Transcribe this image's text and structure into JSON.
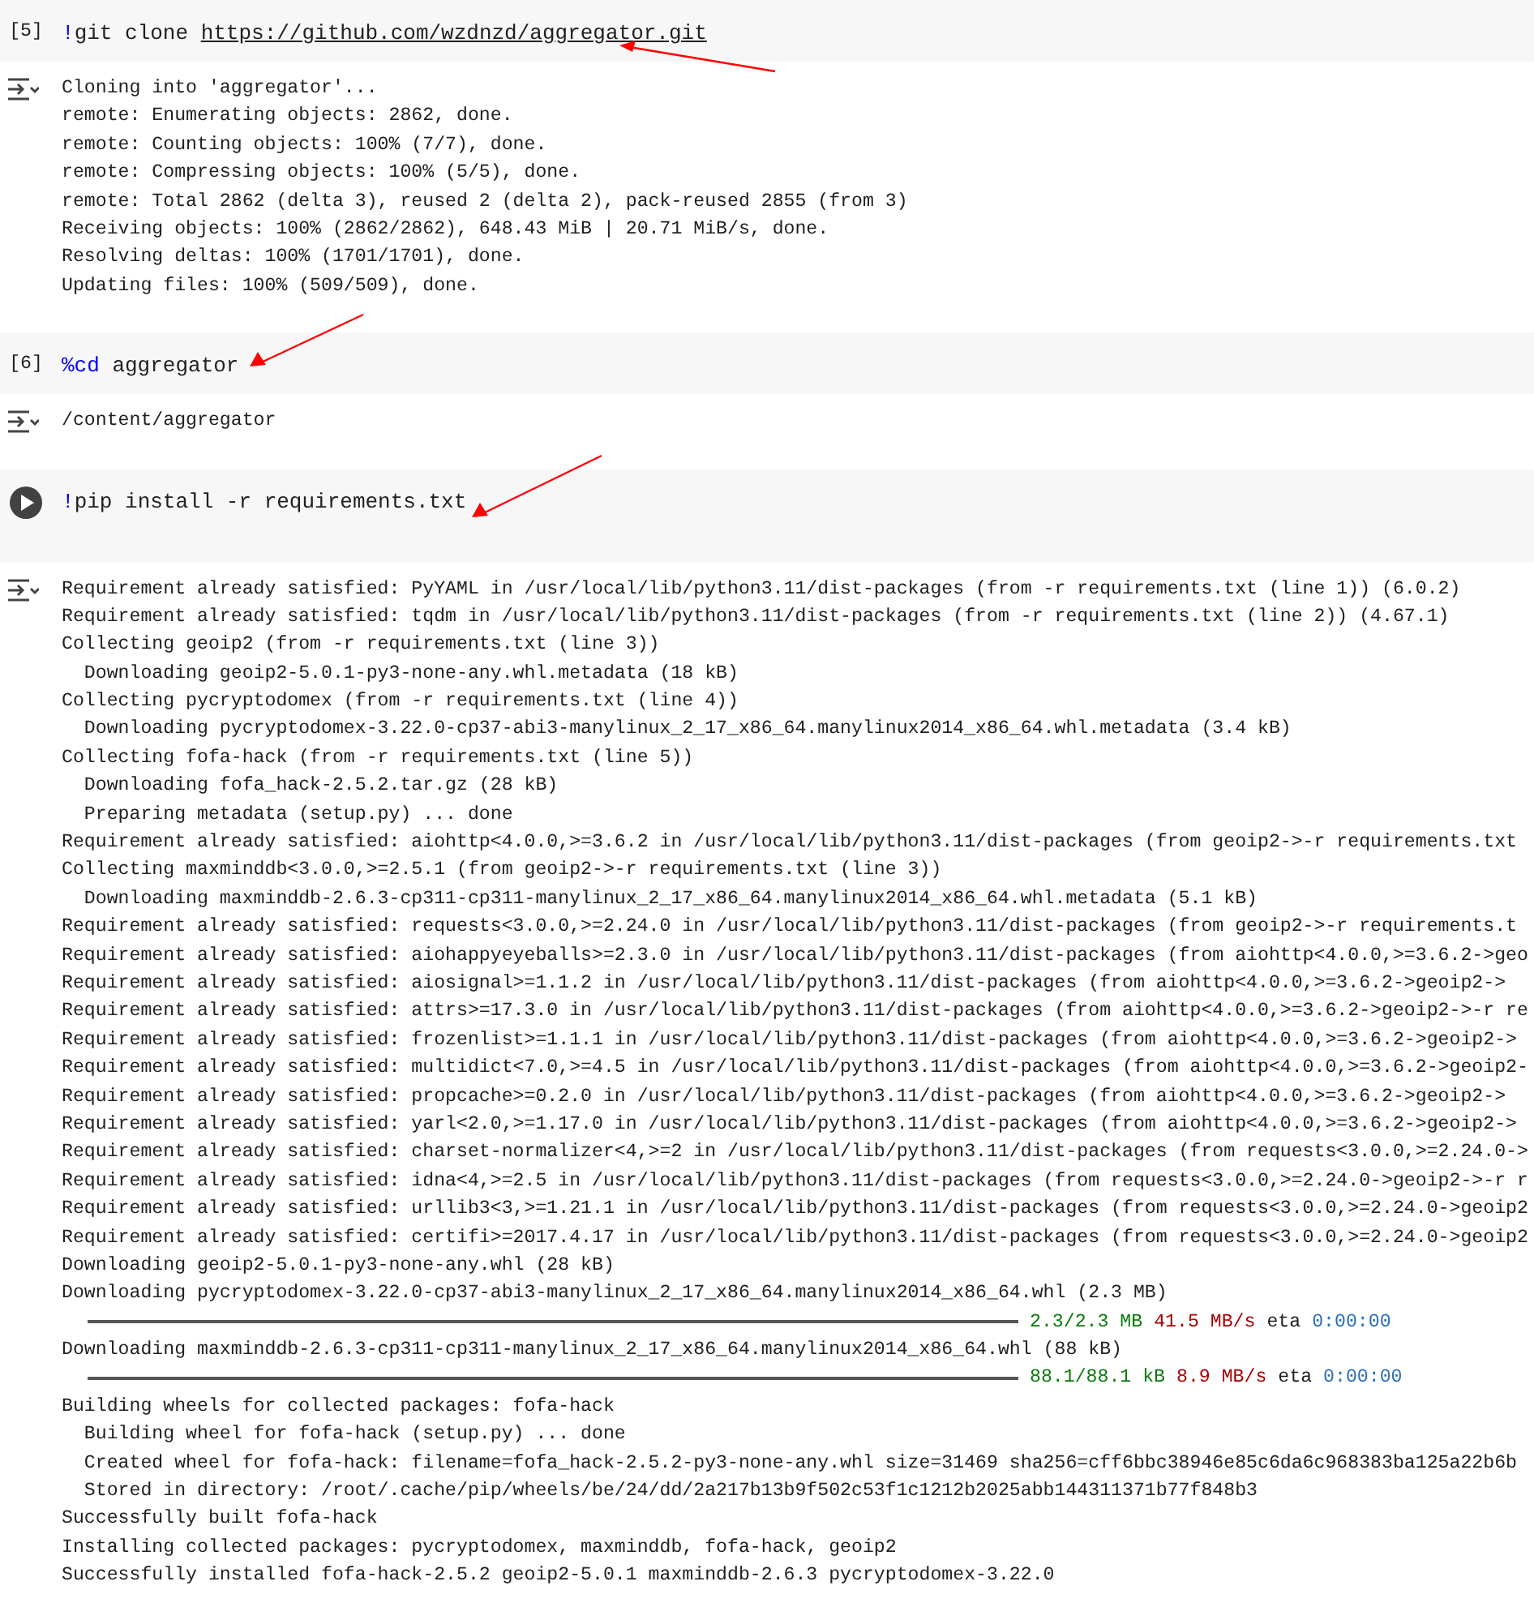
{
  "cells": [
    {
      "kind": "counted",
      "prompt": "[5]",
      "code": [
        {
          "kind": "magic",
          "text": "!"
        },
        {
          "kind": "plain",
          "text": "git clone "
        },
        {
          "kind": "link",
          "text": "https://github.com/wzdnzd/aggregator.git"
        }
      ],
      "output": [
        {
          "kind": "text",
          "text": "Cloning into 'aggregator'..."
        },
        {
          "kind": "text",
          "text": "remote: Enumerating objects: 2862, done."
        },
        {
          "kind": "text",
          "text": "remote: Counting objects: 100% (7/7), done."
        },
        {
          "kind": "text",
          "text": "remote: Compressing objects: 100% (5/5), done."
        },
        {
          "kind": "text",
          "text": "remote: Total 2862 (delta 3), reused 2 (delta 2), pack-reused 2855 (from 3)"
        },
        {
          "kind": "text",
          "text": "Receiving objects: 100% (2862/2862), 648.43 MiB | 20.71 MiB/s, done."
        },
        {
          "kind": "text",
          "text": "Resolving deltas: 100% (1701/1701), done."
        },
        {
          "kind": "text",
          "text": "Updating files: 100% (509/509), done."
        }
      ]
    },
    {
      "kind": "counted",
      "prompt": "[6]",
      "code": [
        {
          "kind": "magic",
          "text": "%cd"
        },
        {
          "kind": "plain",
          "text": " aggregator"
        }
      ],
      "output": [
        {
          "kind": "text",
          "text": "/content/aggregator"
        }
      ]
    },
    {
      "kind": "runnable",
      "code": [
        {
          "kind": "magic",
          "text": "!"
        },
        {
          "kind": "plain",
          "text": "pip install -r requirements.txt"
        }
      ],
      "output": [
        {
          "kind": "text",
          "text": "Requirement already satisfied: PyYAML in /usr/local/lib/python3.11/dist-packages (from -r requirements.txt (line 1)) (6.0.2)"
        },
        {
          "kind": "text",
          "text": "Requirement already satisfied: tqdm in /usr/local/lib/python3.11/dist-packages (from -r requirements.txt (line 2)) (4.67.1)"
        },
        {
          "kind": "text",
          "text": "Collecting geoip2 (from -r requirements.txt (line 3))"
        },
        {
          "kind": "text",
          "text": "  Downloading geoip2-5.0.1-py3-none-any.whl.metadata (18 kB)"
        },
        {
          "kind": "text",
          "text": "Collecting pycryptodomex (from -r requirements.txt (line 4))"
        },
        {
          "kind": "text",
          "text": "  Downloading pycryptodomex-3.22.0-cp37-abi3-manylinux_2_17_x86_64.manylinux2014_x86_64.whl.metadata (3.4 kB)"
        },
        {
          "kind": "text",
          "text": "Collecting fofa-hack (from -r requirements.txt (line 5))"
        },
        {
          "kind": "text",
          "text": "  Downloading fofa_hack-2.5.2.tar.gz (28 kB)"
        },
        {
          "kind": "text",
          "text": "  Preparing metadata (setup.py) ... done"
        },
        {
          "kind": "text",
          "text": "Requirement already satisfied: aiohttp<4.0.0,>=3.6.2 in /usr/local/lib/python3.11/dist-packages (from geoip2->-r requirements.txt"
        },
        {
          "kind": "text",
          "text": "Collecting maxminddb<3.0.0,>=2.5.1 (from geoip2->-r requirements.txt (line 3))"
        },
        {
          "kind": "text",
          "text": "  Downloading maxminddb-2.6.3-cp311-cp311-manylinux_2_17_x86_64.manylinux2014_x86_64.whl.metadata (5.1 kB)"
        },
        {
          "kind": "text",
          "text": "Requirement already satisfied: requests<3.0.0,>=2.24.0 in /usr/local/lib/python3.11/dist-packages (from geoip2->-r requirements.t"
        },
        {
          "kind": "text",
          "text": "Requirement already satisfied: aiohappyeyeballs>=2.3.0 in /usr/local/lib/python3.11/dist-packages (from aiohttp<4.0.0,>=3.6.2->geo"
        },
        {
          "kind": "text",
          "text": "Requirement already satisfied: aiosignal>=1.1.2 in /usr/local/lib/python3.11/dist-packages (from aiohttp<4.0.0,>=3.6.2->geoip2->"
        },
        {
          "kind": "text",
          "text": "Requirement already satisfied: attrs>=17.3.0 in /usr/local/lib/python3.11/dist-packages (from aiohttp<4.0.0,>=3.6.2->geoip2->-r re"
        },
        {
          "kind": "text",
          "text": "Requirement already satisfied: frozenlist>=1.1.1 in /usr/local/lib/python3.11/dist-packages (from aiohttp<4.0.0,>=3.6.2->geoip2->"
        },
        {
          "kind": "text",
          "text": "Requirement already satisfied: multidict<7.0,>=4.5 in /usr/local/lib/python3.11/dist-packages (from aiohttp<4.0.0,>=3.6.2->geoip2-"
        },
        {
          "kind": "text",
          "text": "Requirement already satisfied: propcache>=0.2.0 in /usr/local/lib/python3.11/dist-packages (from aiohttp<4.0.0,>=3.6.2->geoip2->"
        },
        {
          "kind": "text",
          "text": "Requirement already satisfied: yarl<2.0,>=1.17.0 in /usr/local/lib/python3.11/dist-packages (from aiohttp<4.0.0,>=3.6.2->geoip2->"
        },
        {
          "kind": "text",
          "text": "Requirement already satisfied: charset-normalizer<4,>=2 in /usr/local/lib/python3.11/dist-packages (from requests<3.0.0,>=2.24.0->"
        },
        {
          "kind": "text",
          "text": "Requirement already satisfied: idna<4,>=2.5 in /usr/local/lib/python3.11/dist-packages (from requests<3.0.0,>=2.24.0->geoip2->-r r"
        },
        {
          "kind": "text",
          "text": "Requirement already satisfied: urllib3<3,>=1.21.1 in /usr/local/lib/python3.11/dist-packages (from requests<3.0.0,>=2.24.0->geoip2"
        },
        {
          "kind": "text",
          "text": "Requirement already satisfied: certifi>=2017.4.17 in /usr/local/lib/python3.11/dist-packages (from requests<3.0.0,>=2.24.0->geoip2"
        },
        {
          "kind": "text",
          "text": "Downloading geoip2-5.0.1-py3-none-any.whl (28 kB)"
        },
        {
          "kind": "text",
          "text": "Downloading pycryptodomex-3.22.0-cp37-abi3-manylinux_2_17_x86_64.manylinux2014_x86_64.whl (2.3 MB)"
        },
        {
          "kind": "progress",
          "level": 1,
          "size": "2.3/2.3 MB",
          "speed": "41.5 MB/s",
          "eta_label": "eta",
          "eta": "0:00:00"
        },
        {
          "kind": "text",
          "text": "Downloading maxminddb-2.6.3-cp311-cp311-manylinux_2_17_x86_64.manylinux2014_x86_64.whl (88 kB)"
        },
        {
          "kind": "progress",
          "level": 1,
          "size": "88.1/88.1 kB",
          "speed": "8.9 MB/s",
          "eta_label": "eta",
          "eta": "0:00:00"
        },
        {
          "kind": "text",
          "text": "Building wheels for collected packages: fofa-hack"
        },
        {
          "kind": "text",
          "text": "  Building wheel for fofa-hack (setup.py) ... done"
        },
        {
          "kind": "text",
          "text": "  Created wheel for fofa-hack: filename=fofa_hack-2.5.2-py3-none-any.whl size=31469 sha256=cff6bbc38946e85c6da6c968383ba125a22b6b"
        },
        {
          "kind": "text",
          "text": "  Stored in directory: /root/.cache/pip/wheels/be/24/dd/2a217b13b9f502c53f1c1212b2025abb144311371b77f848b3"
        },
        {
          "kind": "text",
          "text": "Successfully built fofa-hack"
        },
        {
          "kind": "text",
          "text": "Installing collected packages: pycryptodomex, maxminddb, fofa-hack, geoip2"
        },
        {
          "kind": "text",
          "text": "Successfully installed fofa-hack-2.5.2 geoip2-5.0.1 maxminddb-2.6.3 pycryptodomex-3.22.0"
        }
      ]
    }
  ]
}
